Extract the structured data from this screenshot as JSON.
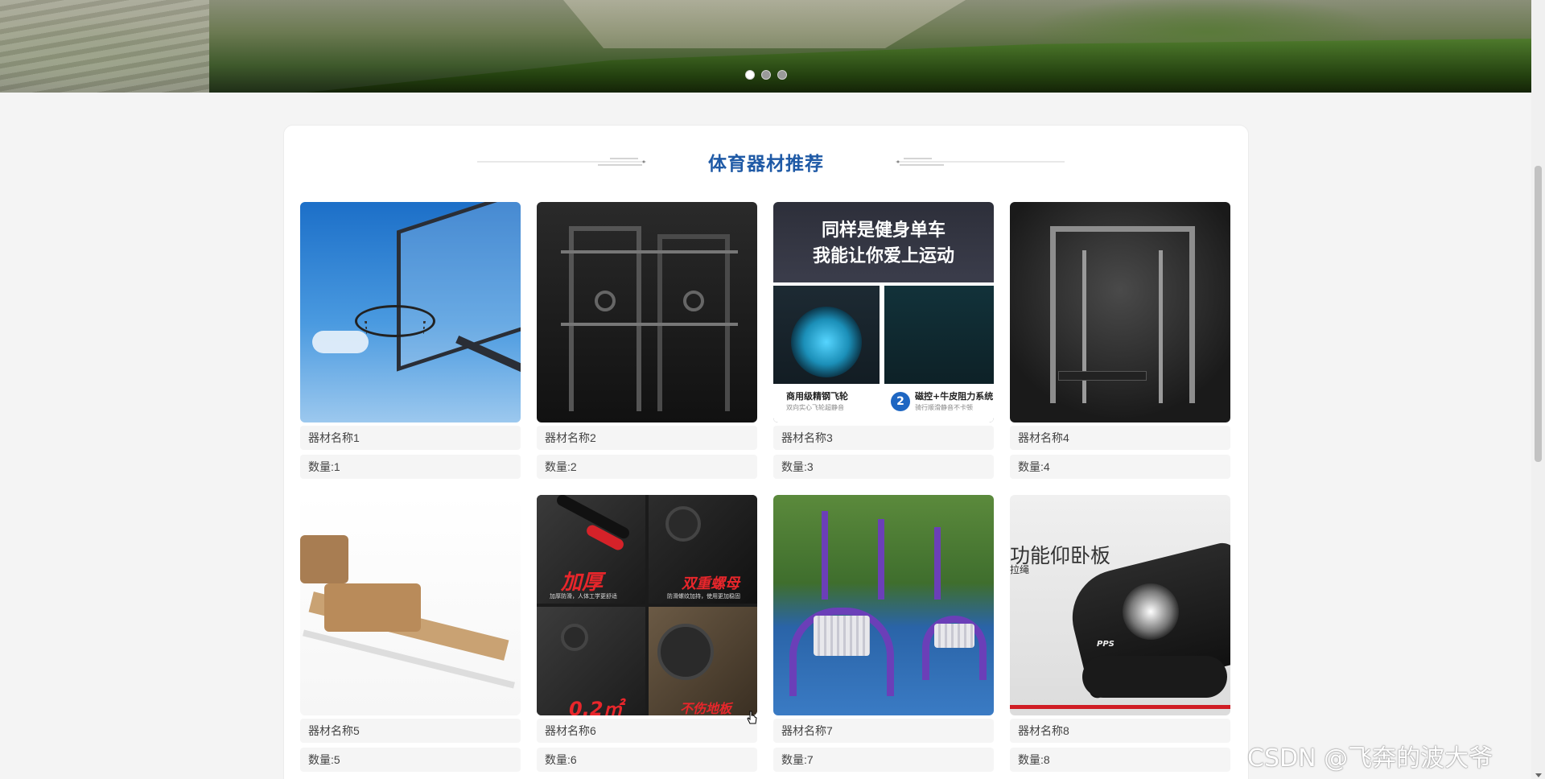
{
  "carousel": {
    "dot_count": 3,
    "active_index": 0
  },
  "section": {
    "title": "体育器材推荐",
    "accent_color": "#1f5aa6"
  },
  "items": [
    {
      "name": "器材名称1",
      "quantity": "数量:1",
      "image": "basketball-hoop"
    },
    {
      "name": "器材名称2",
      "quantity": "数量:2",
      "image": "multi-gym-rack-diagram"
    },
    {
      "name": "器材名称3",
      "quantity": "数量:3",
      "image": "spin-bike-ad",
      "image_text": {
        "headline_1": "同样是健身单车",
        "headline_2": "我能让你爱上运动",
        "feature_1": "商用级精钢飞轮",
        "feature_1_sub": "双向实心飞轮超静音",
        "feature_2_num": "2",
        "feature_2": "磁控+牛皮阻力系统",
        "feature_2_sub": "骑行顺滑静音不卡顿"
      }
    },
    {
      "name": "器材名称4",
      "quantity": "数量:4",
      "image": "smith-machine"
    },
    {
      "name": "器材名称5",
      "quantity": "数量:5",
      "image": "pilates-reformer"
    },
    {
      "name": "器材名称6",
      "quantity": "数量:6",
      "image": "dumbbell-set",
      "image_text": {
        "q1": "加厚",
        "q1_sub": "加厚防滑，人体工学更舒适",
        "q2": "双重螺母",
        "q2_sub": "防滑螺纹加持，使用更加稳固",
        "q3": "0.2㎡",
        "q4": "不伤地板"
      }
    },
    {
      "name": "器材名称7",
      "quantity": "数量:7",
      "image": "outdoor-fitness-equipment"
    },
    {
      "name": "器材名称8",
      "quantity": "数量:8",
      "image": "sit-up-bench",
      "image_text": {
        "big": "功能仰卧板",
        "small": "拉绳",
        "brand": "PPS"
      }
    }
  ],
  "watermark": "CSDN @飞奔的波大爷"
}
